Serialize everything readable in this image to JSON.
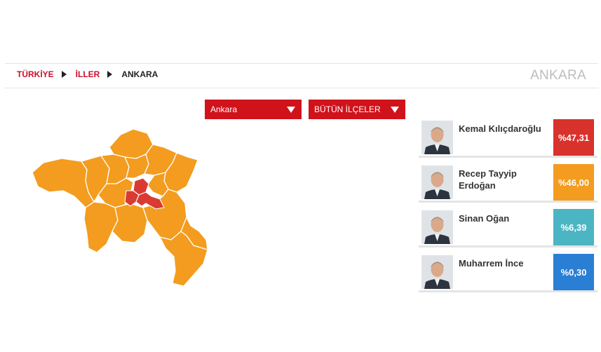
{
  "breadcrumb": {
    "country": "TÜRKİYE",
    "provinces": "İLLER",
    "current": "ANKARA"
  },
  "page_title": "ANKARA",
  "filters": {
    "province_selected": "Ankara",
    "district_selected": "BÜTÜN İLÇELER"
  },
  "colors": {
    "accent": "#d0121b",
    "map_leading": "#f39c1f",
    "map_center": "#d93a32"
  },
  "candidates": [
    {
      "name": "Kemal Kılıçdaroğlu",
      "percent": "%47,31",
      "color": "#d9312b",
      "icon": "candidate-photo"
    },
    {
      "name": "Recep Tayyip Erdoğan",
      "percent": "%46,00",
      "color": "#f39c1f",
      "icon": "candidate-photo"
    },
    {
      "name": "Sinan Oğan",
      "percent": "%6,39",
      "color": "#4cb5c3",
      "icon": "candidate-photo"
    },
    {
      "name": "Muharrem İnce",
      "percent": "%0,30",
      "color": "#2a7fd4",
      "icon": "candidate-photo"
    }
  ]
}
